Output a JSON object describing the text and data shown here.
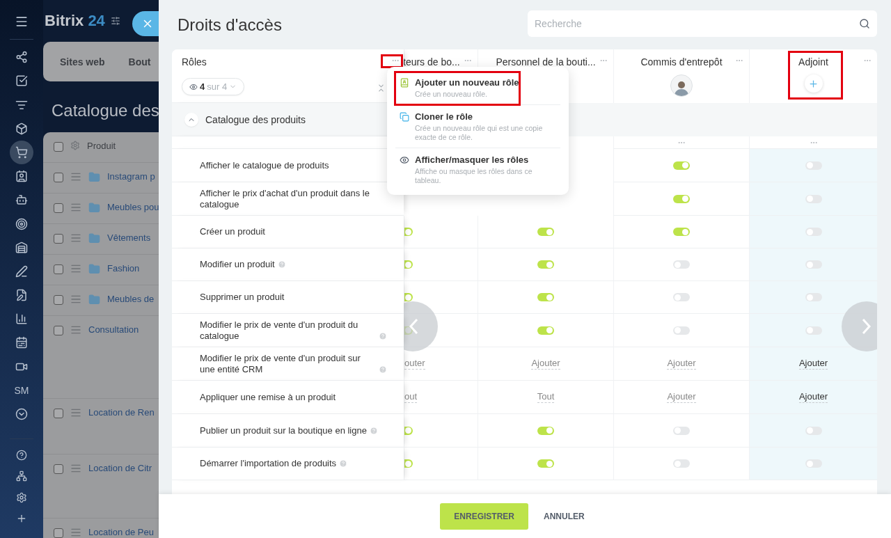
{
  "sidebar": {
    "items": [
      {
        "selected": false
      },
      {
        "selected": false
      },
      {
        "selected": false
      },
      {
        "selected": false
      },
      {
        "selected": true
      },
      {
        "selected": false
      },
      {
        "selected": false
      },
      {
        "selected": false
      },
      {
        "selected": false
      },
      {
        "selected": false
      },
      {
        "selected": false
      },
      {
        "selected": false
      },
      {
        "selected": false
      },
      {
        "selected": false
      },
      {
        "label": "SM",
        "selected": false
      },
      {
        "selected": false
      }
    ],
    "bottom_items": [
      {
        "selected": false
      },
      {
        "selected": false
      },
      {
        "selected": false
      },
      {
        "selected": false
      }
    ]
  },
  "background_page": {
    "logo": {
      "name": "Bitrix",
      "number": "24"
    },
    "tabs": [
      "Sites web",
      "Bout"
    ],
    "title": "Catalogue des",
    "grid": {
      "header": {
        "label": "Produit",
        "checked": false
      },
      "rows": [
        {
          "kind": "folder",
          "label": "Instagram p",
          "checked": false
        },
        {
          "kind": "folder",
          "label": "Meubles pou",
          "checked": false
        },
        {
          "kind": "folder",
          "label": "Vêtements",
          "checked": false
        },
        {
          "kind": "folder",
          "label": "Fashion",
          "checked": false
        },
        {
          "kind": "folder",
          "label": "Meubles de",
          "checked": false
        },
        {
          "kind": "product",
          "label": "Consultation",
          "checked": false
        },
        {
          "kind": "product",
          "label": "Location de Ren",
          "checked": false
        },
        {
          "kind": "product",
          "label": "Location de Citr",
          "checked": false
        },
        {
          "kind": "product",
          "label": "Location de Peu",
          "checked": false
        }
      ]
    }
  },
  "panel": {
    "title": "Droits d'accès",
    "search": {
      "placeholder": "Recherche"
    },
    "roles_header": {
      "title": "Rôles",
      "filter": {
        "count": "4",
        "total": "sur 4"
      }
    },
    "columns": [
      {
        "title": "teurs de bo...",
        "highlighted": false,
        "row_menu": false,
        "kind": "plain"
      },
      {
        "title": "Personnel de la bouti...",
        "highlighted": false,
        "row_menu": false,
        "kind": "plain"
      },
      {
        "title": "Commis d'entrepôt",
        "highlighted": false,
        "row_menu": true,
        "kind": "avatar"
      },
      {
        "title": "Adjoint",
        "highlighted": true,
        "row_menu": true,
        "kind": "add"
      }
    ],
    "section": {
      "title": "Catalogue des produits",
      "expanded": true
    },
    "rows": [
      {
        "label": "Afficher le catalogue de produits",
        "help": false,
        "cells": [
          null,
          null,
          {
            "kind": "toggle",
            "on": true
          },
          {
            "kind": "toggle",
            "on": false
          }
        ]
      },
      {
        "label": "Afficher le prix d'achat d'un produit dans le catalogue",
        "help": false,
        "cells": [
          null,
          null,
          {
            "kind": "toggle",
            "on": true
          },
          {
            "kind": "toggle",
            "on": false
          }
        ]
      },
      {
        "label": "Créer un produit",
        "help": false,
        "cells": [
          {
            "kind": "toggle",
            "on": true
          },
          {
            "kind": "toggle",
            "on": true
          },
          {
            "kind": "toggle",
            "on": true
          },
          {
            "kind": "toggle",
            "on": false
          }
        ]
      },
      {
        "label": "Modifier un produit",
        "help": true,
        "cells": [
          {
            "kind": "toggle",
            "on": true
          },
          {
            "kind": "toggle",
            "on": true
          },
          {
            "kind": "toggle",
            "on": false
          },
          {
            "kind": "toggle",
            "on": false
          }
        ]
      },
      {
        "label": "Supprimer un produit",
        "help": false,
        "cells": [
          {
            "kind": "toggle",
            "on": true
          },
          {
            "kind": "toggle",
            "on": true
          },
          {
            "kind": "toggle",
            "on": false
          },
          {
            "kind": "toggle",
            "on": false
          }
        ]
      },
      {
        "label": "Modifier le prix de vente d'un produit du catalogue",
        "help": true,
        "cells": [
          {
            "kind": "toggle",
            "on": true
          },
          {
            "kind": "toggle",
            "on": true
          },
          {
            "kind": "toggle",
            "on": false
          },
          {
            "kind": "toggle",
            "on": false
          }
        ]
      },
      {
        "label": "Modifier le prix de vente d'un produit sur une entité CRM",
        "help": true,
        "cells": [
          {
            "kind": "link",
            "text": "outer"
          },
          {
            "kind": "link",
            "text": "Ajouter"
          },
          {
            "kind": "link",
            "text": "Ajouter"
          },
          {
            "kind": "link",
            "text": "Ajouter"
          }
        ]
      },
      {
        "label": "Appliquer une remise à un produit",
        "help": false,
        "cells": [
          {
            "kind": "link",
            "text": "out"
          },
          {
            "kind": "link",
            "text": "Tout"
          },
          {
            "kind": "link",
            "text": "Ajouter"
          },
          {
            "kind": "link",
            "text": "Ajouter"
          }
        ]
      },
      {
        "label": "Publier un produit sur la boutique en ligne",
        "help": true,
        "cells": [
          {
            "kind": "toggle",
            "on": true
          },
          {
            "kind": "toggle",
            "on": true
          },
          {
            "kind": "toggle",
            "on": false
          },
          {
            "kind": "toggle",
            "on": false
          }
        ]
      },
      {
        "label": "Démarrer l'importation de produits",
        "help": true,
        "cells": [
          {
            "kind": "toggle",
            "on": true
          },
          {
            "kind": "toggle",
            "on": true
          },
          {
            "kind": "toggle",
            "on": false
          },
          {
            "kind": "toggle",
            "on": false
          }
        ]
      }
    ],
    "menu": [
      {
        "title": "Ajouter un nouveau rôle",
        "description": "Crée un nouveau rôle.",
        "marked": true
      },
      {
        "title": "Cloner le rôle",
        "description": "Crée un nouveau rôle qui est une copie exacte de ce rôle.",
        "marked": false
      },
      {
        "title": "Afficher/masquer les rôles",
        "description": "Affiche ou masque les rôles dans ce tableau.",
        "marked": false
      }
    ],
    "footer": {
      "save": "ENREGISTRER",
      "cancel": "ANNULER"
    }
  }
}
